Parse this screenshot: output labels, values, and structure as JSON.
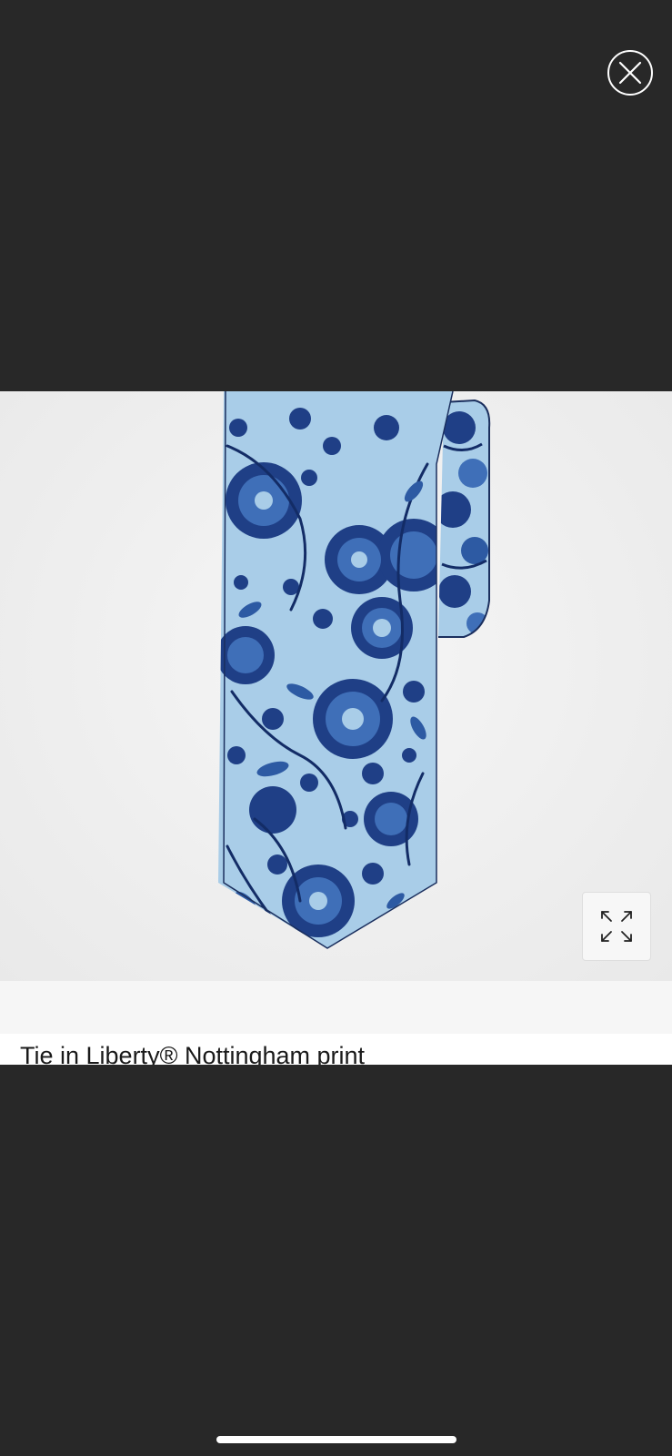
{
  "viewer": {
    "close_icon": "close-x-circle-icon",
    "expand_icon": "expand-arrows-icon",
    "image_alt": "Tie in Liberty® Nottingham print"
  },
  "product": {
    "title": "Tie in Liberty® Nottingham print"
  },
  "colors": {
    "backdrop": "#282828",
    "tie_light_blue": "#a9cde8",
    "tie_navy": "#1f3f86",
    "tie_mid_blue": "#3f6fb8"
  }
}
